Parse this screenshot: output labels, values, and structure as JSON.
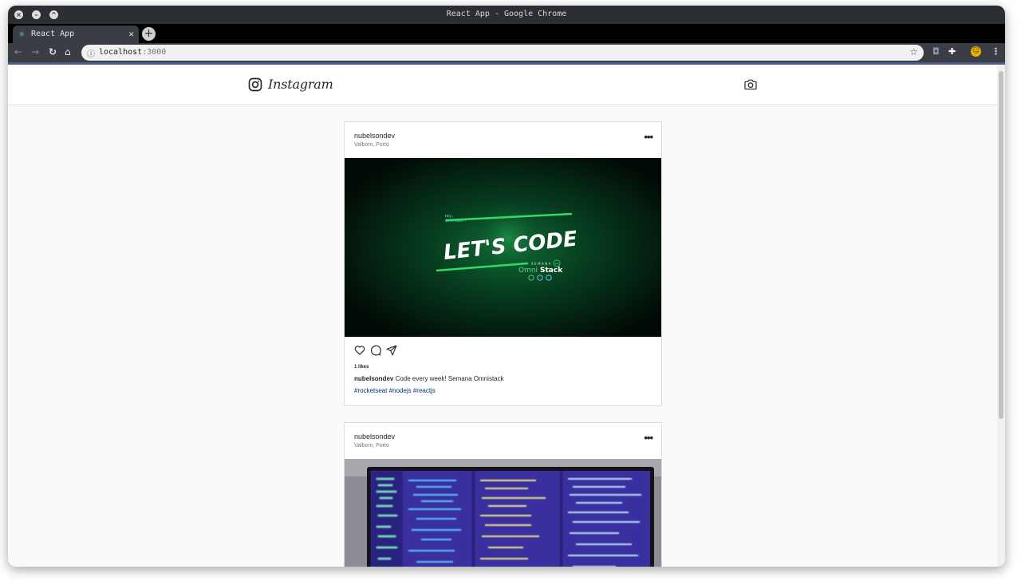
{
  "browser": {
    "window_title": "React App - Google Chrome",
    "tab_title": "React App",
    "url_host": "localhost",
    "url_port": ":3000"
  },
  "app": {
    "logo_text": "Instagram",
    "colors": {
      "link": "#003569",
      "border": "#dddddd",
      "text": "#262626"
    }
  },
  "posts": [
    {
      "author": "nubelsondev",
      "place": "Valbom, Porto",
      "image": {
        "greeting_1": "Hey,",
        "greeting_2": "Developer!",
        "headline": "LET'S CODE",
        "tag_small": "SEMANA",
        "tag_num": "04",
        "brand_a": "Omni",
        "brand_b": "Stack"
      },
      "likes": "1 likes",
      "caption_author": "nubelsondev",
      "caption_text": " Code every week! Semana Omnistack",
      "hashtags": "#rocketseat #nodejs #reactjs"
    },
    {
      "author": "nubelsondev",
      "place": "Valbom, Porto"
    }
  ]
}
